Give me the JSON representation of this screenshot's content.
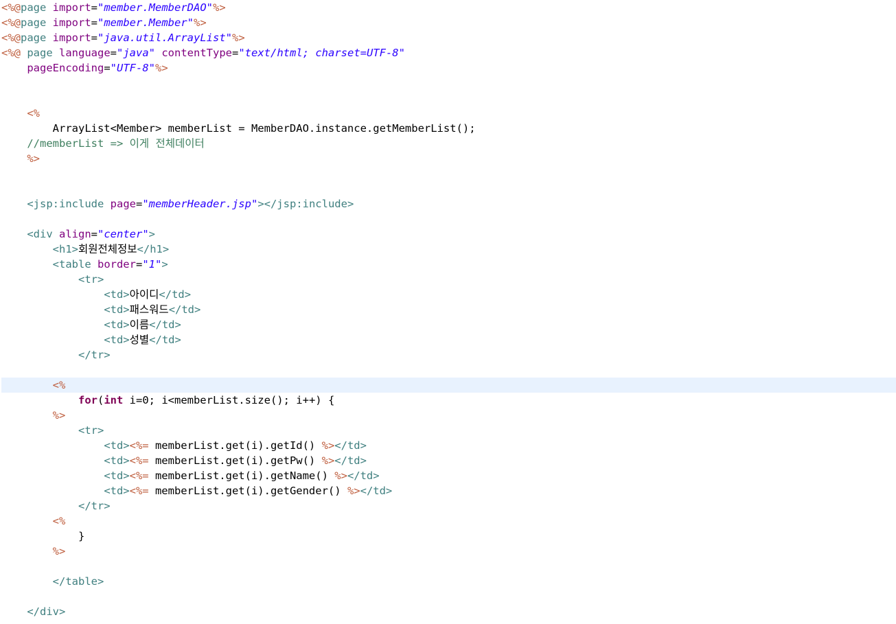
{
  "editor": {
    "current_line": 26,
    "colors": {
      "background": "#ffffff",
      "current_line_highlight": "#e8f2fe",
      "jsp_delimiter": "#bf5f3f",
      "tag": "#3f7f7f",
      "attribute": "#7f007f",
      "string": "#2a00ff",
      "comment": "#3f7f5f",
      "keyword": "#7f0055",
      "plain": "#000000"
    },
    "lines": [
      [
        [
          "delim",
          "<%@"
        ],
        [
          "directive",
          "page "
        ],
        [
          "attr",
          "import"
        ],
        [
          "plain",
          "="
        ],
        [
          "str",
          "\"member.MemberDAO\""
        ],
        [
          "delim",
          "%>"
        ]
      ],
      [
        [
          "delim",
          "<%@"
        ],
        [
          "directive",
          "page "
        ],
        [
          "attr",
          "import"
        ],
        [
          "plain",
          "="
        ],
        [
          "str",
          "\"member.Member\""
        ],
        [
          "delim",
          "%>"
        ]
      ],
      [
        [
          "delim",
          "<%@"
        ],
        [
          "directive",
          "page "
        ],
        [
          "attr",
          "import"
        ],
        [
          "plain",
          "="
        ],
        [
          "str",
          "\"java.util.ArrayList\""
        ],
        [
          "delim",
          "%>"
        ]
      ],
      [
        [
          "delim",
          "<%@"
        ],
        [
          "directive",
          " page "
        ],
        [
          "attr",
          "language"
        ],
        [
          "plain",
          "="
        ],
        [
          "str",
          "\"java\""
        ],
        [
          "plain",
          " "
        ],
        [
          "attr",
          "contentType"
        ],
        [
          "plain",
          "="
        ],
        [
          "str",
          "\"text/html; charset=UTF-8\""
        ]
      ],
      [
        [
          "plain",
          "    "
        ],
        [
          "attr",
          "pageEncoding"
        ],
        [
          "plain",
          "="
        ],
        [
          "str",
          "\"UTF-8\""
        ],
        [
          "delim",
          "%>"
        ]
      ],
      [],
      [],
      [
        [
          "plain",
          "    "
        ],
        [
          "delim",
          "<%"
        ]
      ],
      [
        [
          "plain",
          "        ArrayList<Member> memberList = MemberDAO.instance.getMemberList();"
        ]
      ],
      [
        [
          "plain",
          "    "
        ],
        [
          "comment",
          "//memberList => 이게 전체데이터"
        ]
      ],
      [
        [
          "plain",
          "    "
        ],
        [
          "delim",
          "%>"
        ]
      ],
      [],
      [],
      [
        [
          "plain",
          "    "
        ],
        [
          "tag",
          "<jsp:include "
        ],
        [
          "attr",
          "page"
        ],
        [
          "plain",
          "="
        ],
        [
          "str",
          "\"memberHeader.jsp\""
        ],
        [
          "tag",
          "></jsp:include>"
        ]
      ],
      [],
      [
        [
          "plain",
          "    "
        ],
        [
          "tag",
          "<div "
        ],
        [
          "attr",
          "align"
        ],
        [
          "plain",
          "="
        ],
        [
          "str",
          "\"center\""
        ],
        [
          "tag",
          ">"
        ]
      ],
      [
        [
          "plain",
          "        "
        ],
        [
          "tag",
          "<h1>"
        ],
        [
          "plain",
          "회원전체정보"
        ],
        [
          "tag",
          "</h1>"
        ]
      ],
      [
        [
          "plain",
          "        "
        ],
        [
          "tag",
          "<table "
        ],
        [
          "attr",
          "border"
        ],
        [
          "plain",
          "="
        ],
        [
          "str",
          "\"1\""
        ],
        [
          "tag",
          ">"
        ]
      ],
      [
        [
          "plain",
          "            "
        ],
        [
          "tag",
          "<tr>"
        ]
      ],
      [
        [
          "plain",
          "                "
        ],
        [
          "tag",
          "<td>"
        ],
        [
          "plain",
          "아이디"
        ],
        [
          "tag",
          "</td>"
        ]
      ],
      [
        [
          "plain",
          "                "
        ],
        [
          "tag",
          "<td>"
        ],
        [
          "plain",
          "패스워드"
        ],
        [
          "tag",
          "</td>"
        ]
      ],
      [
        [
          "plain",
          "                "
        ],
        [
          "tag",
          "<td>"
        ],
        [
          "plain",
          "이름"
        ],
        [
          "tag",
          "</td>"
        ]
      ],
      [
        [
          "plain",
          "                "
        ],
        [
          "tag",
          "<td>"
        ],
        [
          "plain",
          "성별"
        ],
        [
          "tag",
          "</td>"
        ]
      ],
      [
        [
          "plain",
          "            "
        ],
        [
          "tag",
          "</tr>"
        ]
      ],
      [],
      [
        [
          "plain",
          "        "
        ],
        [
          "delim",
          "<%"
        ]
      ],
      [
        [
          "plain",
          "            "
        ],
        [
          "kw",
          "for"
        ],
        [
          "plain",
          "("
        ],
        [
          "kw",
          "int"
        ],
        [
          "plain",
          " i=0; i<memberList.size(); i++) {"
        ]
      ],
      [
        [
          "plain",
          "        "
        ],
        [
          "delim",
          "%>"
        ]
      ],
      [
        [
          "plain",
          "            "
        ],
        [
          "tag",
          "<tr>"
        ]
      ],
      [
        [
          "plain",
          "                "
        ],
        [
          "tag",
          "<td>"
        ],
        [
          "delim",
          "<%="
        ],
        [
          "plain",
          " memberList.get(i).getId() "
        ],
        [
          "delim",
          "%>"
        ],
        [
          "tag",
          "</td>"
        ]
      ],
      [
        [
          "plain",
          "                "
        ],
        [
          "tag",
          "<td>"
        ],
        [
          "delim",
          "<%="
        ],
        [
          "plain",
          " memberList.get(i).getPw() "
        ],
        [
          "delim",
          "%>"
        ],
        [
          "tag",
          "</td>"
        ]
      ],
      [
        [
          "plain",
          "                "
        ],
        [
          "tag",
          "<td>"
        ],
        [
          "delim",
          "<%="
        ],
        [
          "plain",
          " memberList.get(i).getName() "
        ],
        [
          "delim",
          "%>"
        ],
        [
          "tag",
          "</td>"
        ]
      ],
      [
        [
          "plain",
          "                "
        ],
        [
          "tag",
          "<td>"
        ],
        [
          "delim",
          "<%="
        ],
        [
          "plain",
          " memberList.get(i).getGender() "
        ],
        [
          "delim",
          "%>"
        ],
        [
          "tag",
          "</td>"
        ]
      ],
      [
        [
          "plain",
          "            "
        ],
        [
          "tag",
          "</tr>"
        ]
      ],
      [
        [
          "plain",
          "        "
        ],
        [
          "delim",
          "<%"
        ]
      ],
      [
        [
          "plain",
          "            }"
        ]
      ],
      [
        [
          "plain",
          "        "
        ],
        [
          "delim",
          "%>"
        ]
      ],
      [],
      [
        [
          "plain",
          "        "
        ],
        [
          "tag",
          "</table>"
        ]
      ],
      [],
      [
        [
          "plain",
          "    "
        ],
        [
          "tag",
          "</div>"
        ]
      ]
    ]
  }
}
